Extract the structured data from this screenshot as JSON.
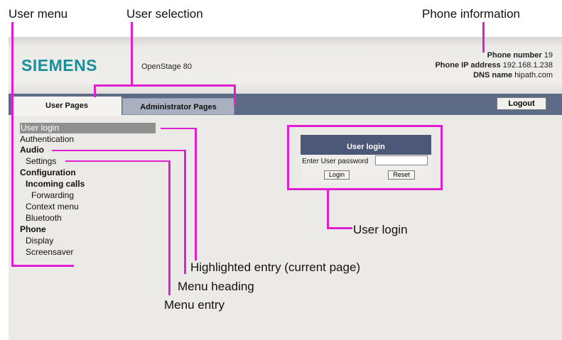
{
  "annotations": {
    "user_menu": "User menu",
    "user_selection": "User selection",
    "phone_information": "Phone information",
    "user_login": "User login",
    "highlighted_entry": "Highlighted entry (current page)",
    "menu_heading": "Menu heading",
    "menu_entry": "Menu entry"
  },
  "header": {
    "logo": "SIEMENS",
    "model": "OpenStage 80",
    "phone_number_label": "Phone number",
    "phone_number": "19",
    "ip_label": "Phone IP address",
    "ip": "192.168.1.238",
    "dns_label": "DNS name",
    "dns": "hipath.com"
  },
  "tabs": {
    "user": "User Pages",
    "admin": "Administrator Pages",
    "logout": "Logout"
  },
  "menu": {
    "items": [
      {
        "label": "User login",
        "type": "entry",
        "highlighted": true
      },
      {
        "label": "Authentication",
        "type": "entry"
      },
      {
        "label": "Audio",
        "type": "heading"
      },
      {
        "label": "Settings",
        "type": "entry"
      },
      {
        "label": "Configuration",
        "type": "heading"
      },
      {
        "label": "Incoming calls",
        "type": "heading"
      },
      {
        "label": "Forwarding",
        "type": "entry"
      },
      {
        "label": "Context menu",
        "type": "entry"
      },
      {
        "label": "Bluetooth",
        "type": "entry"
      },
      {
        "label": "Phone",
        "type": "heading"
      },
      {
        "label": "Display",
        "type": "entry"
      },
      {
        "label": "Screensaver",
        "type": "entry"
      }
    ]
  },
  "login_panel": {
    "title": "User login",
    "password_label": "Enter User password",
    "password_value": "",
    "login_button": "Login",
    "reset_button": "Reset"
  },
  "colors": {
    "annotation": "#e020d0",
    "tabbar": "#5d6b86",
    "logo": "#1a8f99",
    "login_panel": "#4d5777"
  }
}
